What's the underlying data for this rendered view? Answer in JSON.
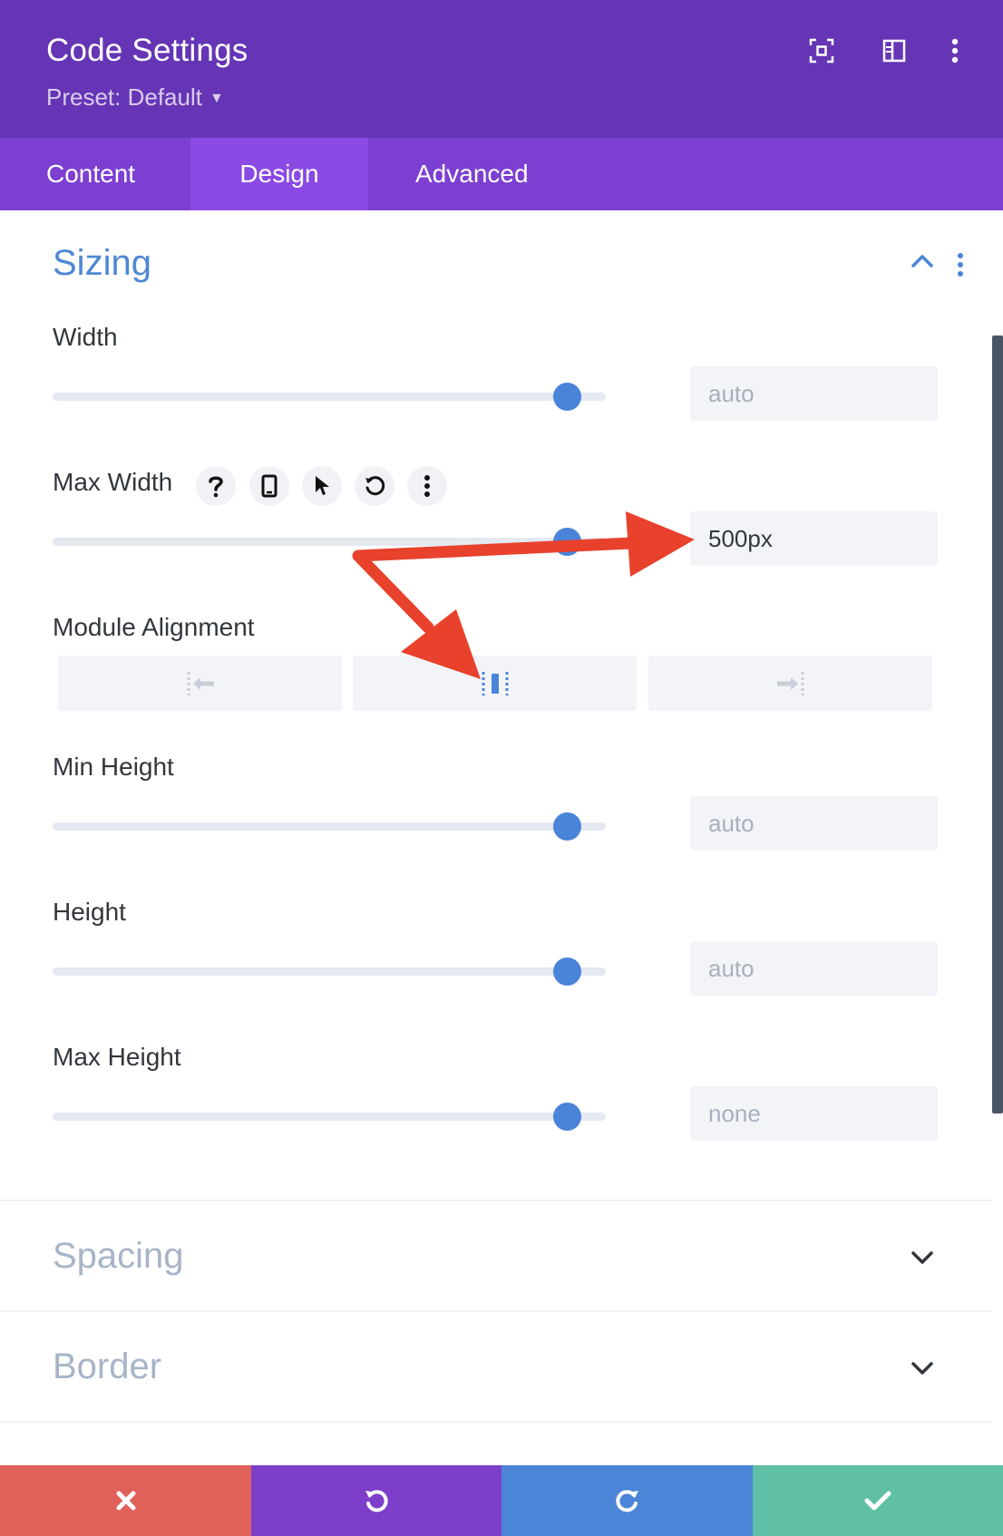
{
  "header": {
    "title": "Code Settings",
    "preset": "Preset: Default",
    "icons": [
      "focus-icon",
      "sidebar-layout-icon",
      "more-vertical-icon"
    ],
    "background_color": "#6535b5"
  },
  "tabs": [
    {
      "label": "Content",
      "active": false
    },
    {
      "label": "Design",
      "active": true
    },
    {
      "label": "Advanced",
      "active": false
    }
  ],
  "sizing": {
    "title": "Sizing",
    "width": {
      "label": "Width",
      "value": "auto",
      "slider_fraction": 0.93
    },
    "max_width": {
      "label": "Max Width",
      "value": "500px",
      "slider_fraction": 0.93,
      "option_icons": [
        "help-icon",
        "responsive-phone-icon",
        "hover-cursor-icon",
        "reset-icon",
        "more-vertical-icon"
      ]
    },
    "module_alignment": {
      "label": "Module Alignment",
      "options": [
        "align-left-icon",
        "align-center-icon",
        "align-right-icon"
      ],
      "selected": "align-center-icon"
    },
    "min_height": {
      "label": "Min Height",
      "value": "auto",
      "slider_fraction": 0.93
    },
    "height": {
      "label": "Height",
      "value": "auto",
      "slider_fraction": 0.93
    },
    "max_height": {
      "label": "Max Height",
      "value": "none",
      "slider_fraction": 0.93
    }
  },
  "collapsed_sections": [
    {
      "title": "Spacing"
    },
    {
      "title": "Border"
    }
  ],
  "footer": {
    "buttons": [
      {
        "icon": "close-icon",
        "color": "#e0605a"
      },
      {
        "icon": "undo-icon",
        "color": "#7d3fc9"
      },
      {
        "icon": "redo-icon",
        "color": "#4c85d8"
      },
      {
        "icon": "check-icon",
        "color": "#5fc0a5"
      }
    ]
  },
  "colors": {
    "accent_blue": "#4a84d9",
    "annotation_arrow": "#e8412c"
  }
}
